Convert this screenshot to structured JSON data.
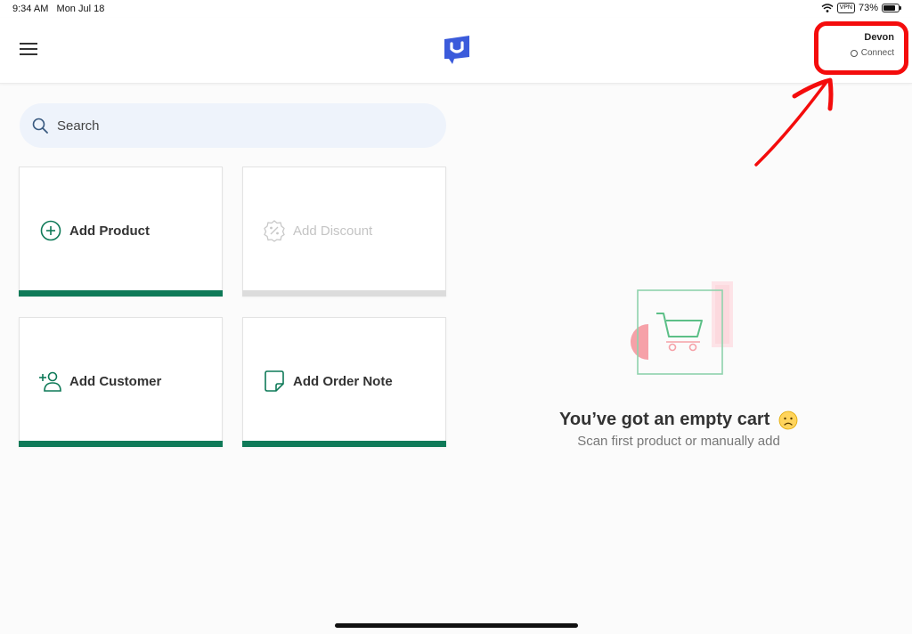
{
  "status_bar": {
    "time": "9:34 AM",
    "date": "Mon Jul 18",
    "vpn": "VPN",
    "battery": "73%",
    "battery_level": 0.73
  },
  "header": {
    "user_name": "Devon",
    "connect_label": "Connect"
  },
  "search": {
    "placeholder": "Search"
  },
  "tiles": [
    {
      "label": "Add Product",
      "enabled": true,
      "icon": "plus-circle-icon"
    },
    {
      "label": "Add Discount",
      "enabled": false,
      "icon": "percent-badge-icon"
    },
    {
      "label": "Add Customer",
      "enabled": true,
      "icon": "add-user-icon"
    },
    {
      "label": "Add Order Note",
      "enabled": true,
      "icon": "note-icon"
    }
  ],
  "empty_cart": {
    "title": "You’ve got an empty cart",
    "subtitle": "Scan first product or manually add"
  },
  "colors": {
    "accent_green": "#0f7a58",
    "logo_blue": "#3b5bdb",
    "annotation_red": "#f40c0c",
    "search_bg": "#eef3fb"
  }
}
